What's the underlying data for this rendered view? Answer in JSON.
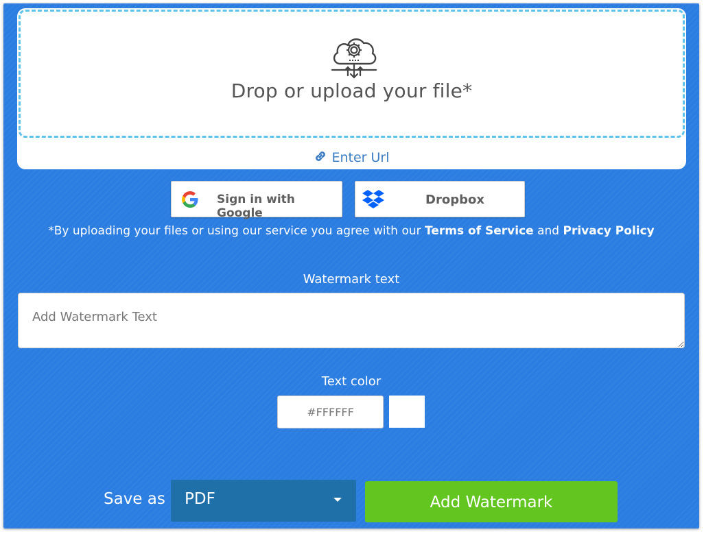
{
  "upload": {
    "drop_text": "Drop or upload your file*",
    "url_link": "Enter Url",
    "icon": "cloud-gear-icon"
  },
  "auth": {
    "google_label": "Sign in with Google",
    "dropbox_label": "Dropbox"
  },
  "terms": {
    "prefix": "*By uploading your files or using our service you agree with our",
    "tos": "Terms of Service",
    "and": "and",
    "privacy": "Privacy Policy"
  },
  "watermark": {
    "label": "Watermark text",
    "placeholder": "Add Watermark Text",
    "value": ""
  },
  "text_color": {
    "label": "Text color",
    "value": "#FFFFFF",
    "swatch": "#FFFFFF"
  },
  "save": {
    "label": "Save as",
    "format": "PDF"
  },
  "action": {
    "add_label": "Add Watermark"
  },
  "colors": {
    "panel": "#2b7de1",
    "dropzone_border": "#5ec3ea",
    "link": "#3b7dc4",
    "select_bg": "#1f6fa9",
    "primary_button": "#63c51f"
  }
}
